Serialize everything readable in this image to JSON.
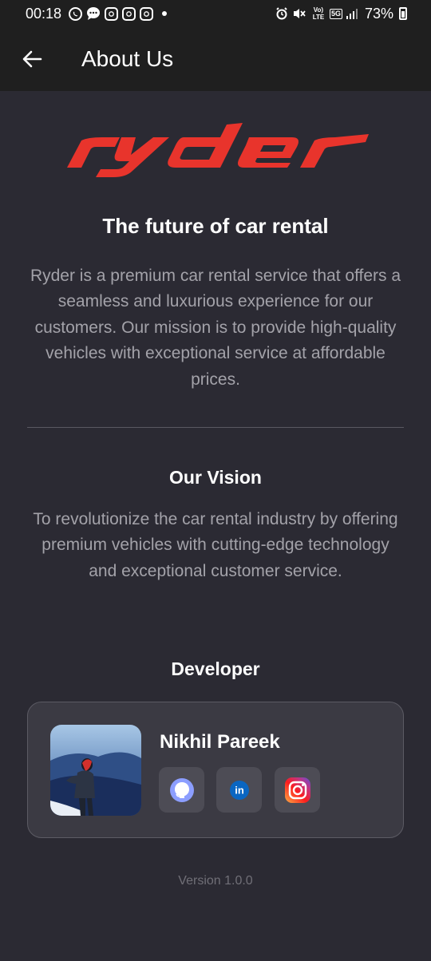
{
  "status_bar": {
    "time": "00:18",
    "battery": "73%",
    "network_label": "5G",
    "volte_label": "Vo) LTE"
  },
  "app_bar": {
    "title": "About Us"
  },
  "brand": {
    "logo_text": "ryder",
    "logo_color": "#e8342c"
  },
  "hero": {
    "tagline": "The future of car rental",
    "description": "Ryder is a premium car rental service that offers a seamless and luxurious experience for our customers. Our mission is to provide high-quality vehicles with exceptional service at affordable prices."
  },
  "vision": {
    "title": "Our Vision",
    "text": "To revolutionize the car rental industry by offering premium vehicles with cutting-edge technology and exceptional customer service."
  },
  "developer": {
    "section_title": "Developer",
    "name": "Nikhil Pareek",
    "links": [
      {
        "icon": "github-icon"
      },
      {
        "icon": "linkedin-icon",
        "label": "in"
      },
      {
        "icon": "instagram-icon"
      }
    ]
  },
  "footer": {
    "version": "Version 1.0.0"
  },
  "colors": {
    "background": "#2b2a33",
    "app_bar": "#1f1f1f",
    "card": "#3b3a43",
    "muted_text": "#a3a2a9",
    "accent_red": "#e8342c"
  }
}
